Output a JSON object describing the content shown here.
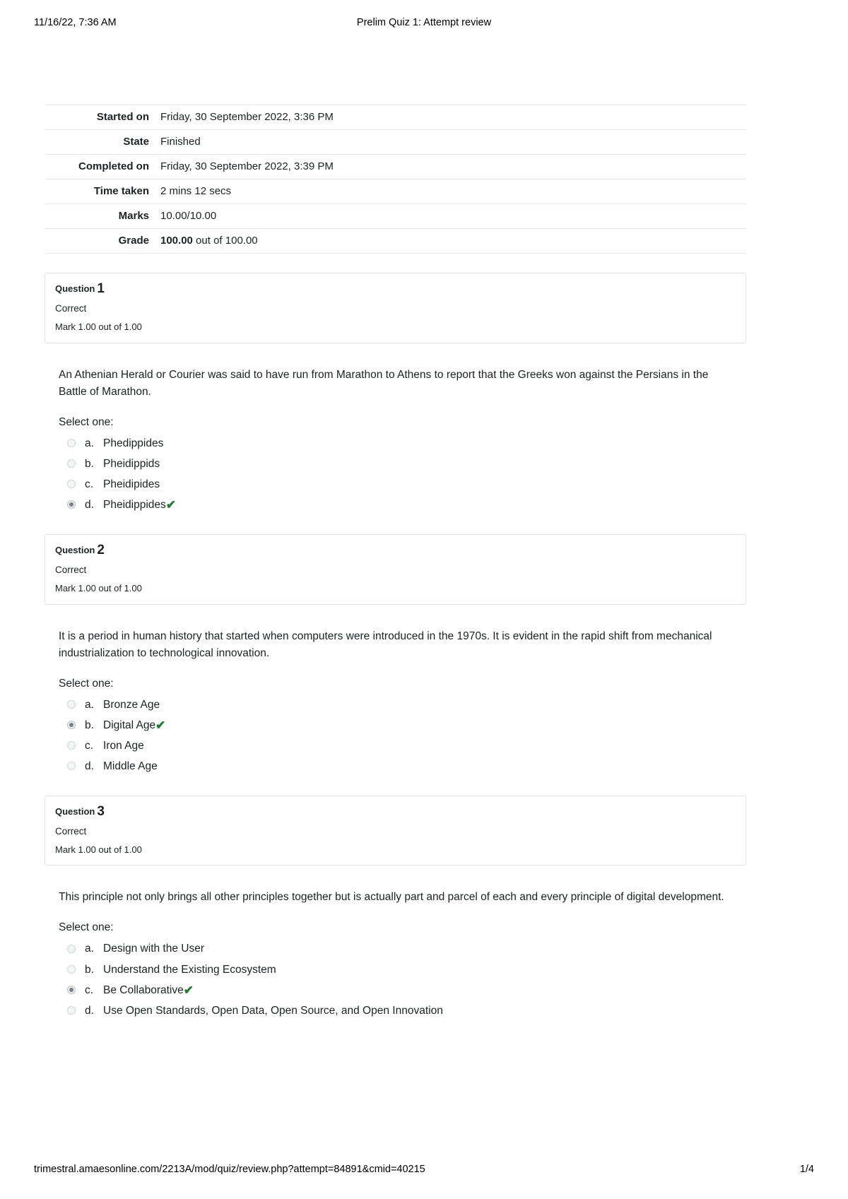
{
  "header": {
    "date": "11/16/22, 7:36 AM",
    "title": "Prelim Quiz 1: Attempt review"
  },
  "footer": {
    "url": "trimestral.amaesonline.com/2213A/mod/quiz/review.php?attempt=84891&cmid=40215",
    "page": "1/4"
  },
  "summary": {
    "rows": [
      {
        "label": "Started on",
        "value": "Friday, 30 September 2022, 3:36 PM"
      },
      {
        "label": "State",
        "value": "Finished"
      },
      {
        "label": "Completed on",
        "value": "Friday, 30 September 2022, 3:39 PM"
      },
      {
        "label": "Time taken",
        "value": "2 mins 12 secs"
      },
      {
        "label": "Marks",
        "value": "10.00/10.00"
      }
    ],
    "grade": {
      "label": "Grade",
      "value_bold": "100.00",
      "value_rest": " out of 100.00"
    }
  },
  "answer_prompt": "Select one:",
  "icons": {
    "correct_tick": "✔"
  },
  "colors": {
    "correct_green": "#1f7a32",
    "box_border": "#dee2e6",
    "table_rule": "#e8eaec"
  },
  "questions": [
    {
      "label": "Question",
      "number": "1",
      "state": "Correct",
      "grade": "Mark 1.00 out of 1.00",
      "text": "An Athenian Herald or Courier was said to have run from Marathon to Athens to report that the Greeks won against the Persians in the Battle of Marathon.",
      "options": [
        {
          "letter": "a.",
          "text": "Phedippides",
          "selected": false,
          "correct": false
        },
        {
          "letter": "b.",
          "text": "Pheidippids",
          "selected": false,
          "correct": false
        },
        {
          "letter": "c.",
          "text": "Pheidipides",
          "selected": false,
          "correct": false
        },
        {
          "letter": "d.",
          "text": "Pheidippides",
          "selected": true,
          "correct": true
        }
      ]
    },
    {
      "label": "Question",
      "number": "2",
      "state": "Correct",
      "grade": "Mark 1.00 out of 1.00",
      "text": "It is a period in human history that started when computers were introduced in the 1970s. It is evident in the rapid shift from mechanical industrialization to technological innovation.",
      "options": [
        {
          "letter": "a.",
          "text": "Bronze Age",
          "selected": false,
          "correct": false
        },
        {
          "letter": "b.",
          "text": "Digital Age",
          "selected": true,
          "correct": true
        },
        {
          "letter": "c.",
          "text": "Iron Age",
          "selected": false,
          "correct": false
        },
        {
          "letter": "d.",
          "text": "Middle Age",
          "selected": false,
          "correct": false
        }
      ]
    },
    {
      "label": "Question",
      "number": "3",
      "state": "Correct",
      "grade": "Mark 1.00 out of 1.00",
      "text": "This principle not only brings all other principles together but is actually part and parcel of each and every principle of digital development.",
      "options": [
        {
          "letter": "a.",
          "text": "Design with the User",
          "selected": false,
          "correct": false
        },
        {
          "letter": "b.",
          "text": "Understand the Existing Ecosystem",
          "selected": false,
          "correct": false
        },
        {
          "letter": "c.",
          "text": "Be Collaborative",
          "selected": true,
          "correct": true
        },
        {
          "letter": "d.",
          "text": "Use Open Standards, Open Data, Open Source, and Open Innovation",
          "selected": false,
          "correct": false
        }
      ]
    }
  ]
}
